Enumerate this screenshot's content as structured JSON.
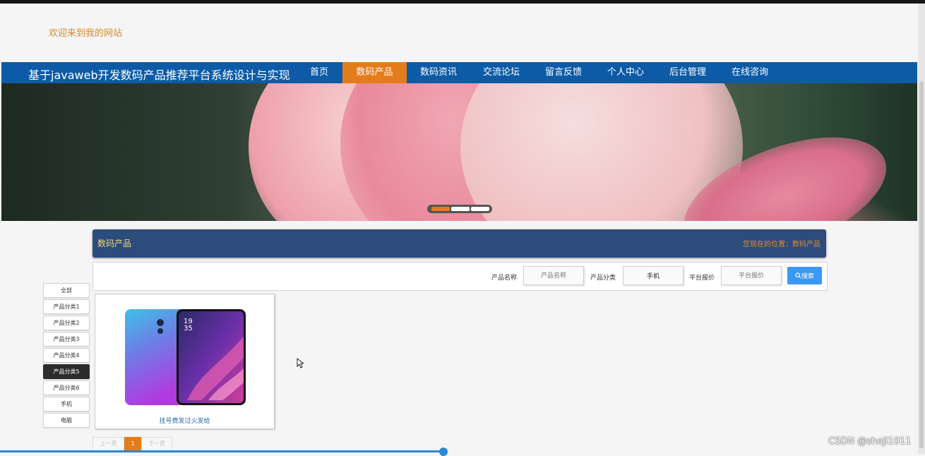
{
  "header": {
    "welcome": "欢迎来到我的网站"
  },
  "nav": {
    "site_title": "基于javaweb开发数码产品推荐平台系统设计与实现",
    "items": [
      {
        "label": "首页"
      },
      {
        "label": "数码产品"
      },
      {
        "label": "数码资讯"
      },
      {
        "label": "交流论坛"
      },
      {
        "label": "留言反馈"
      },
      {
        "label": "个人中心"
      },
      {
        "label": "后台管理"
      },
      {
        "label": "在线咨询"
      }
    ],
    "active_index": 1
  },
  "banner": {
    "slide_count": 3,
    "active_slide": 0
  },
  "section": {
    "title": "数码产品",
    "breadcrumb": "您现在的位置：数码产品"
  },
  "search": {
    "name_label": "产品名称",
    "name_placeholder": "产品名称",
    "category_label": "产品分类",
    "category_value": "手机",
    "price_label": "平台报价",
    "price_placeholder": "平台报价",
    "button_label": "搜索"
  },
  "categories": [
    {
      "label": "全部"
    },
    {
      "label": "产品分类1"
    },
    {
      "label": "产品分类2"
    },
    {
      "label": "产品分类3"
    },
    {
      "label": "产品分类4"
    },
    {
      "label": "产品分类5"
    },
    {
      "label": "产品分类6"
    },
    {
      "label": "手机"
    },
    {
      "label": "电脑"
    }
  ],
  "active_category_index": 5,
  "products": [
    {
      "name": "挂号费发过火发给",
      "phone_time": "19\n35"
    }
  ],
  "pagination": {
    "prev": "上一页",
    "current": "1",
    "next": "下一页"
  },
  "watermark": "CSDN @sheji1011",
  "colors": {
    "nav_bg": "#0d5ba7",
    "accent": "#e57c1b",
    "section_bg": "#2c4c7c",
    "search_button": "#3a99f6"
  }
}
